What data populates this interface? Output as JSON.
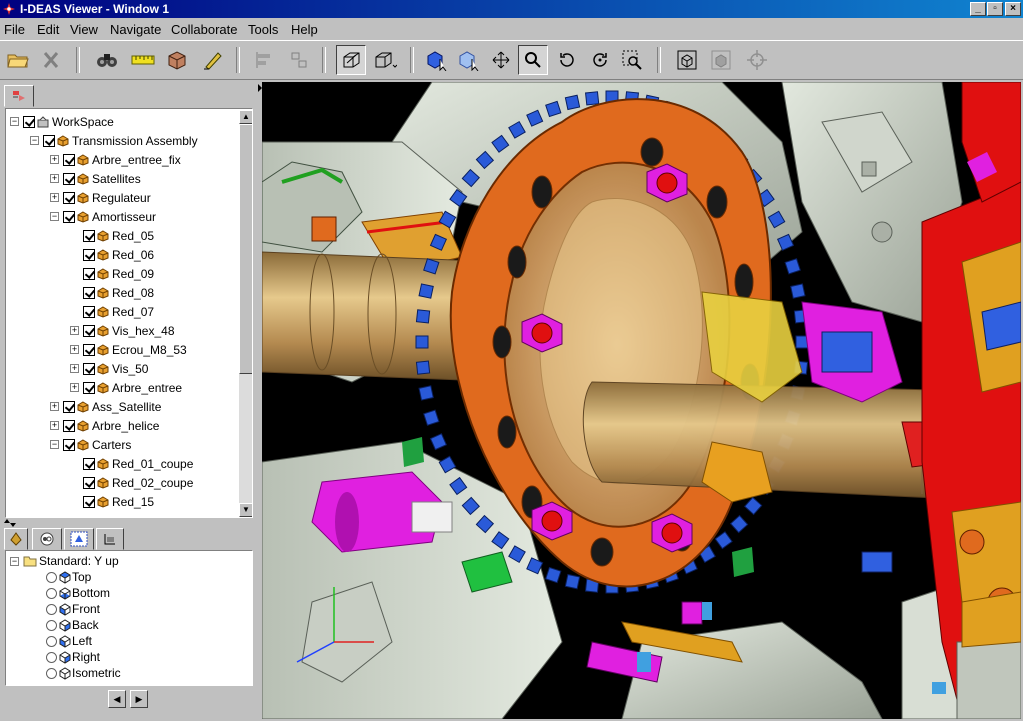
{
  "window": {
    "title": "I-DEAS Viewer - Window 1",
    "min_label": "_",
    "max_label": "▫",
    "close_label": "×"
  },
  "menu": [
    "File",
    "Edit",
    "View",
    "Navigate",
    "Collaborate",
    "Tools",
    "Help"
  ],
  "toolbar": {
    "icons": [
      "open-folder-icon",
      "delete-icon",
      "binoculars-icon",
      "ruler-icon",
      "cube-box-icon",
      "markup-pen-icon",
      "align-left-icon",
      "align-right-icon",
      "perspective-view-icon",
      "box-view-icon",
      "select-blue-icon",
      "select-box-icon",
      "pan-icon",
      "zoom-icon",
      "rotate-icon",
      "rotate-z-icon",
      "zoom-window-icon",
      "wireframe-icon",
      "shaded-icon",
      "target-icon"
    ]
  },
  "tree": {
    "rows": [
      {
        "label": "WorkSpace",
        "level": 0,
        "expander": "-"
      },
      {
        "label": "Transmission Assembly",
        "level": 1,
        "expander": "-"
      },
      {
        "label": "Arbre_entree_fix",
        "level": 2,
        "expander": "+"
      },
      {
        "label": "Satellites",
        "level": 2,
        "expander": "+"
      },
      {
        "label": "Regulateur",
        "level": 2,
        "expander": "+"
      },
      {
        "label": "Amortisseur",
        "level": 2,
        "expander": "-"
      },
      {
        "label": "Red_05",
        "level": 3,
        "expander": ""
      },
      {
        "label": "Red_06",
        "level": 3,
        "expander": ""
      },
      {
        "label": "Red_09",
        "level": 3,
        "expander": ""
      },
      {
        "label": "Red_08",
        "level": 3,
        "expander": ""
      },
      {
        "label": "Red_07",
        "level": 3,
        "expander": ""
      },
      {
        "label": "Vis_hex_48",
        "level": 3,
        "expander": "+"
      },
      {
        "label": "Ecrou_M8_53",
        "level": 3,
        "expander": "+"
      },
      {
        "label": "Vis_50",
        "level": 3,
        "expander": "+"
      },
      {
        "label": "Arbre_entree",
        "level": 3,
        "expander": "+"
      },
      {
        "label": "Ass_Satellite",
        "level": 2,
        "expander": "+"
      },
      {
        "label": "Arbre_helice",
        "level": 2,
        "expander": "+"
      },
      {
        "label": "Carters",
        "level": 2,
        "expander": "-"
      },
      {
        "label": "Red_01_coupe",
        "level": 3,
        "expander": ""
      },
      {
        "label": "Red_02_coupe",
        "level": 3,
        "expander": ""
      },
      {
        "label": "Red_15",
        "level": 3,
        "expander": ""
      }
    ]
  },
  "views": {
    "root": "Standard: Y up",
    "items": [
      "Top",
      "Bottom",
      "Front",
      "Back",
      "Left",
      "Right",
      "Isometric"
    ]
  },
  "colors": {
    "title_bar": "#000080",
    "panel_bg": "#c0c0c0",
    "viewport_bg": "#000000",
    "gear_orange": "#e06a1e",
    "gear_blue": "#2a5ad8",
    "shaft_tan": "#c8a060",
    "housing_gray": "#c8cec4",
    "accent_magenta": "#e020e0",
    "accent_red": "#e01010"
  }
}
